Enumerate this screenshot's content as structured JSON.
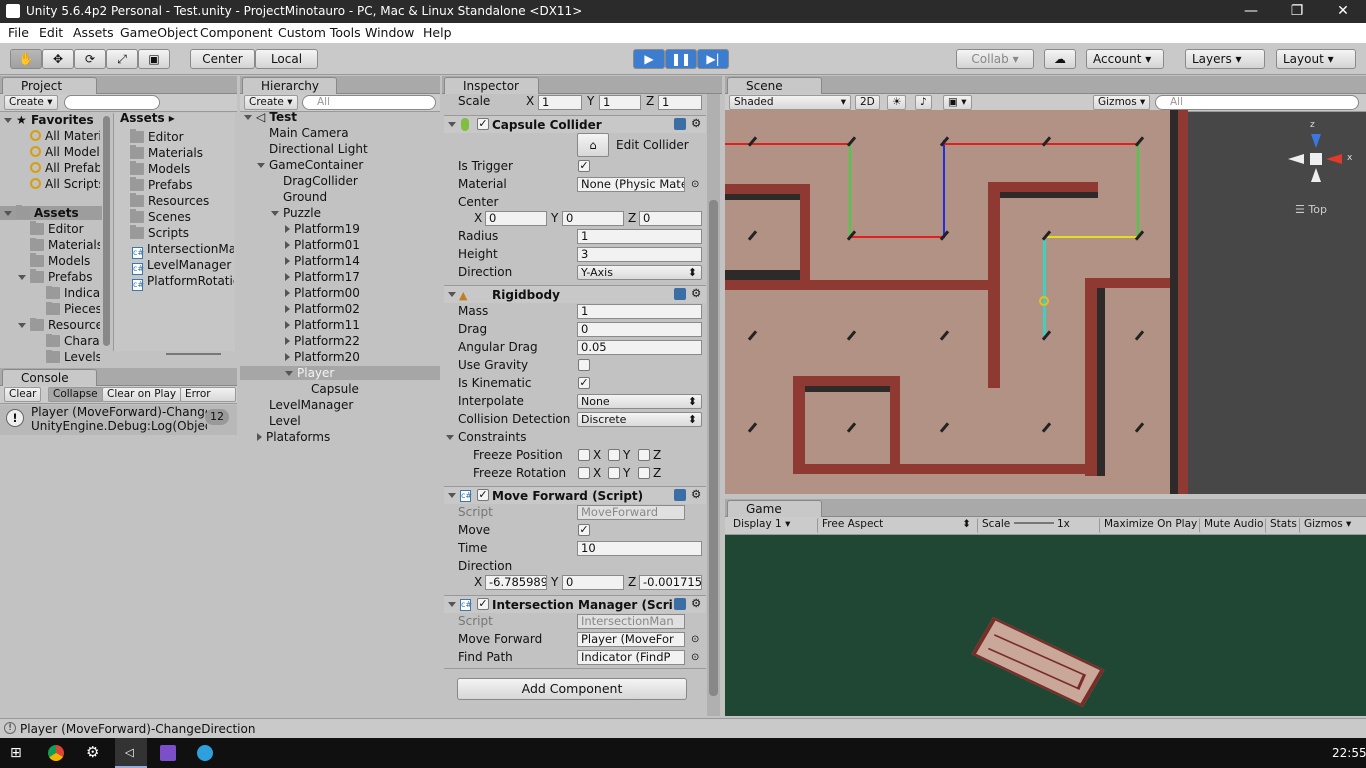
{
  "window": {
    "title": "Unity 5.6.4p2 Personal - Test.unity - ProjectMinotauro - PC, Mac & Linux Standalone <DX11>",
    "min": "—",
    "restore": "❐",
    "close": "✕"
  },
  "menu": [
    "File",
    "Edit",
    "Assets",
    "GameObject",
    "Component",
    "Custom Tools",
    "Window",
    "Help"
  ],
  "toolbar": {
    "pivot": "Center",
    "space": "Local",
    "collab": "Collab ▾",
    "account": "Account",
    "layers": "Layers",
    "layout": "Layout"
  },
  "project": {
    "tab": "Project",
    "create": "Create",
    "favorites_title": "Favorites",
    "favorites": [
      "All Materials",
      "All Models",
      "All Prefabs",
      "All Scripts"
    ],
    "assets_root": "Assets",
    "tree": [
      "Editor",
      "Materials",
      "Models",
      "Prefabs",
      "Indicator",
      "Pieces",
      "Resources",
      "Characters",
      "Levels"
    ],
    "assets_header": "Assets",
    "assets_items": [
      "Editor",
      "Materials",
      "Models",
      "Prefabs",
      "Resources",
      "Scenes",
      "Scripts",
      "IntersectionManager",
      "LevelManager",
      "PlatformRotation"
    ]
  },
  "console": {
    "tab": "Console",
    "clear": "Clear",
    "collapse": "Collapse",
    "clear_on_play": "Clear on Play",
    "error_pause": "Error Pause",
    "msg1": "Player (MoveForward)-ChangeDirection",
    "msg2": "UnityEngine.Debug:Log(Object)",
    "count": "12"
  },
  "hierarchy": {
    "tab": "Hierarchy",
    "create": "Create",
    "search": "All",
    "scene": "Test",
    "items": [
      "Main Camera",
      "Directional Light",
      "GameContainer",
      "DragCollider",
      "Ground",
      "Puzzle",
      "Platform19",
      "Platform01",
      "Platform14",
      "Platform17",
      "Platform00",
      "Platform02",
      "Platform11",
      "Platform22",
      "Platform20",
      "Player",
      "Capsule",
      "LevelManager",
      "Level",
      "Plataforms"
    ]
  },
  "inspector": {
    "tab": "Inspector",
    "scale_label": "Scale",
    "scale": [
      "1",
      "1",
      "1"
    ],
    "capsule": {
      "title": "Capsule Collider",
      "edit": "Edit Collider",
      "is_trigger": "Is Trigger",
      "material": "Material",
      "material_val": "None (Physic Mate",
      "center": "Center",
      "center_val": [
        "0",
        "0",
        "0"
      ],
      "radius": "Radius",
      "radius_val": "1",
      "height": "Height",
      "height_val": "3",
      "direction": "Direction",
      "direction_val": "Y-Axis"
    },
    "rigidbody": {
      "title": "Rigidbody",
      "mass": "Mass",
      "mass_val": "1",
      "drag": "Drag",
      "drag_val": "0",
      "angular_drag": "Angular Drag",
      "angular_drag_val": "0.05",
      "use_gravity": "Use Gravity",
      "is_kinematic": "Is Kinematic",
      "interpolate": "Interpolate",
      "interpolate_val": "None",
      "collision": "Collision Detection",
      "collision_val": "Discrete",
      "constraints": "Constraints",
      "freeze_pos": "Freeze Position",
      "freeze_rot": "Freeze Rotation"
    },
    "move": {
      "title": "Move Forward (Script)",
      "script": "Script",
      "script_val": "MoveForward",
      "move": "Move",
      "time": "Time",
      "time_val": "10",
      "direction": "Direction",
      "dir_val": [
        "-6.785989",
        "0",
        "-0.001715"
      ]
    },
    "inter": {
      "title": "Intersection Manager (Scri",
      "script": "Script",
      "script_val": "IntersectionMan",
      "move_forward": "Move Forward",
      "move_forward_val": "Player (MoveFor",
      "find_path": "Find Path",
      "find_path_val": "Indicator (FindP"
    },
    "add_component": "Add Component"
  },
  "scene": {
    "tab": "Scene",
    "shaded": "Shaded",
    "mode2d": "2D",
    "gizmos": "Gizmos",
    "search": "All",
    "view": "Top"
  },
  "game": {
    "tab": "Game",
    "display": "Display 1",
    "aspect": "Free Aspect",
    "scale": "Scale",
    "scale_val": "1x",
    "maximize": "Maximize On Play",
    "mute": "Mute Audio",
    "stats": "Stats",
    "gizmos": "Gizmos"
  },
  "status": "Player (MoveForward)-ChangeDirection",
  "taskbar": {
    "time": "22:55"
  }
}
